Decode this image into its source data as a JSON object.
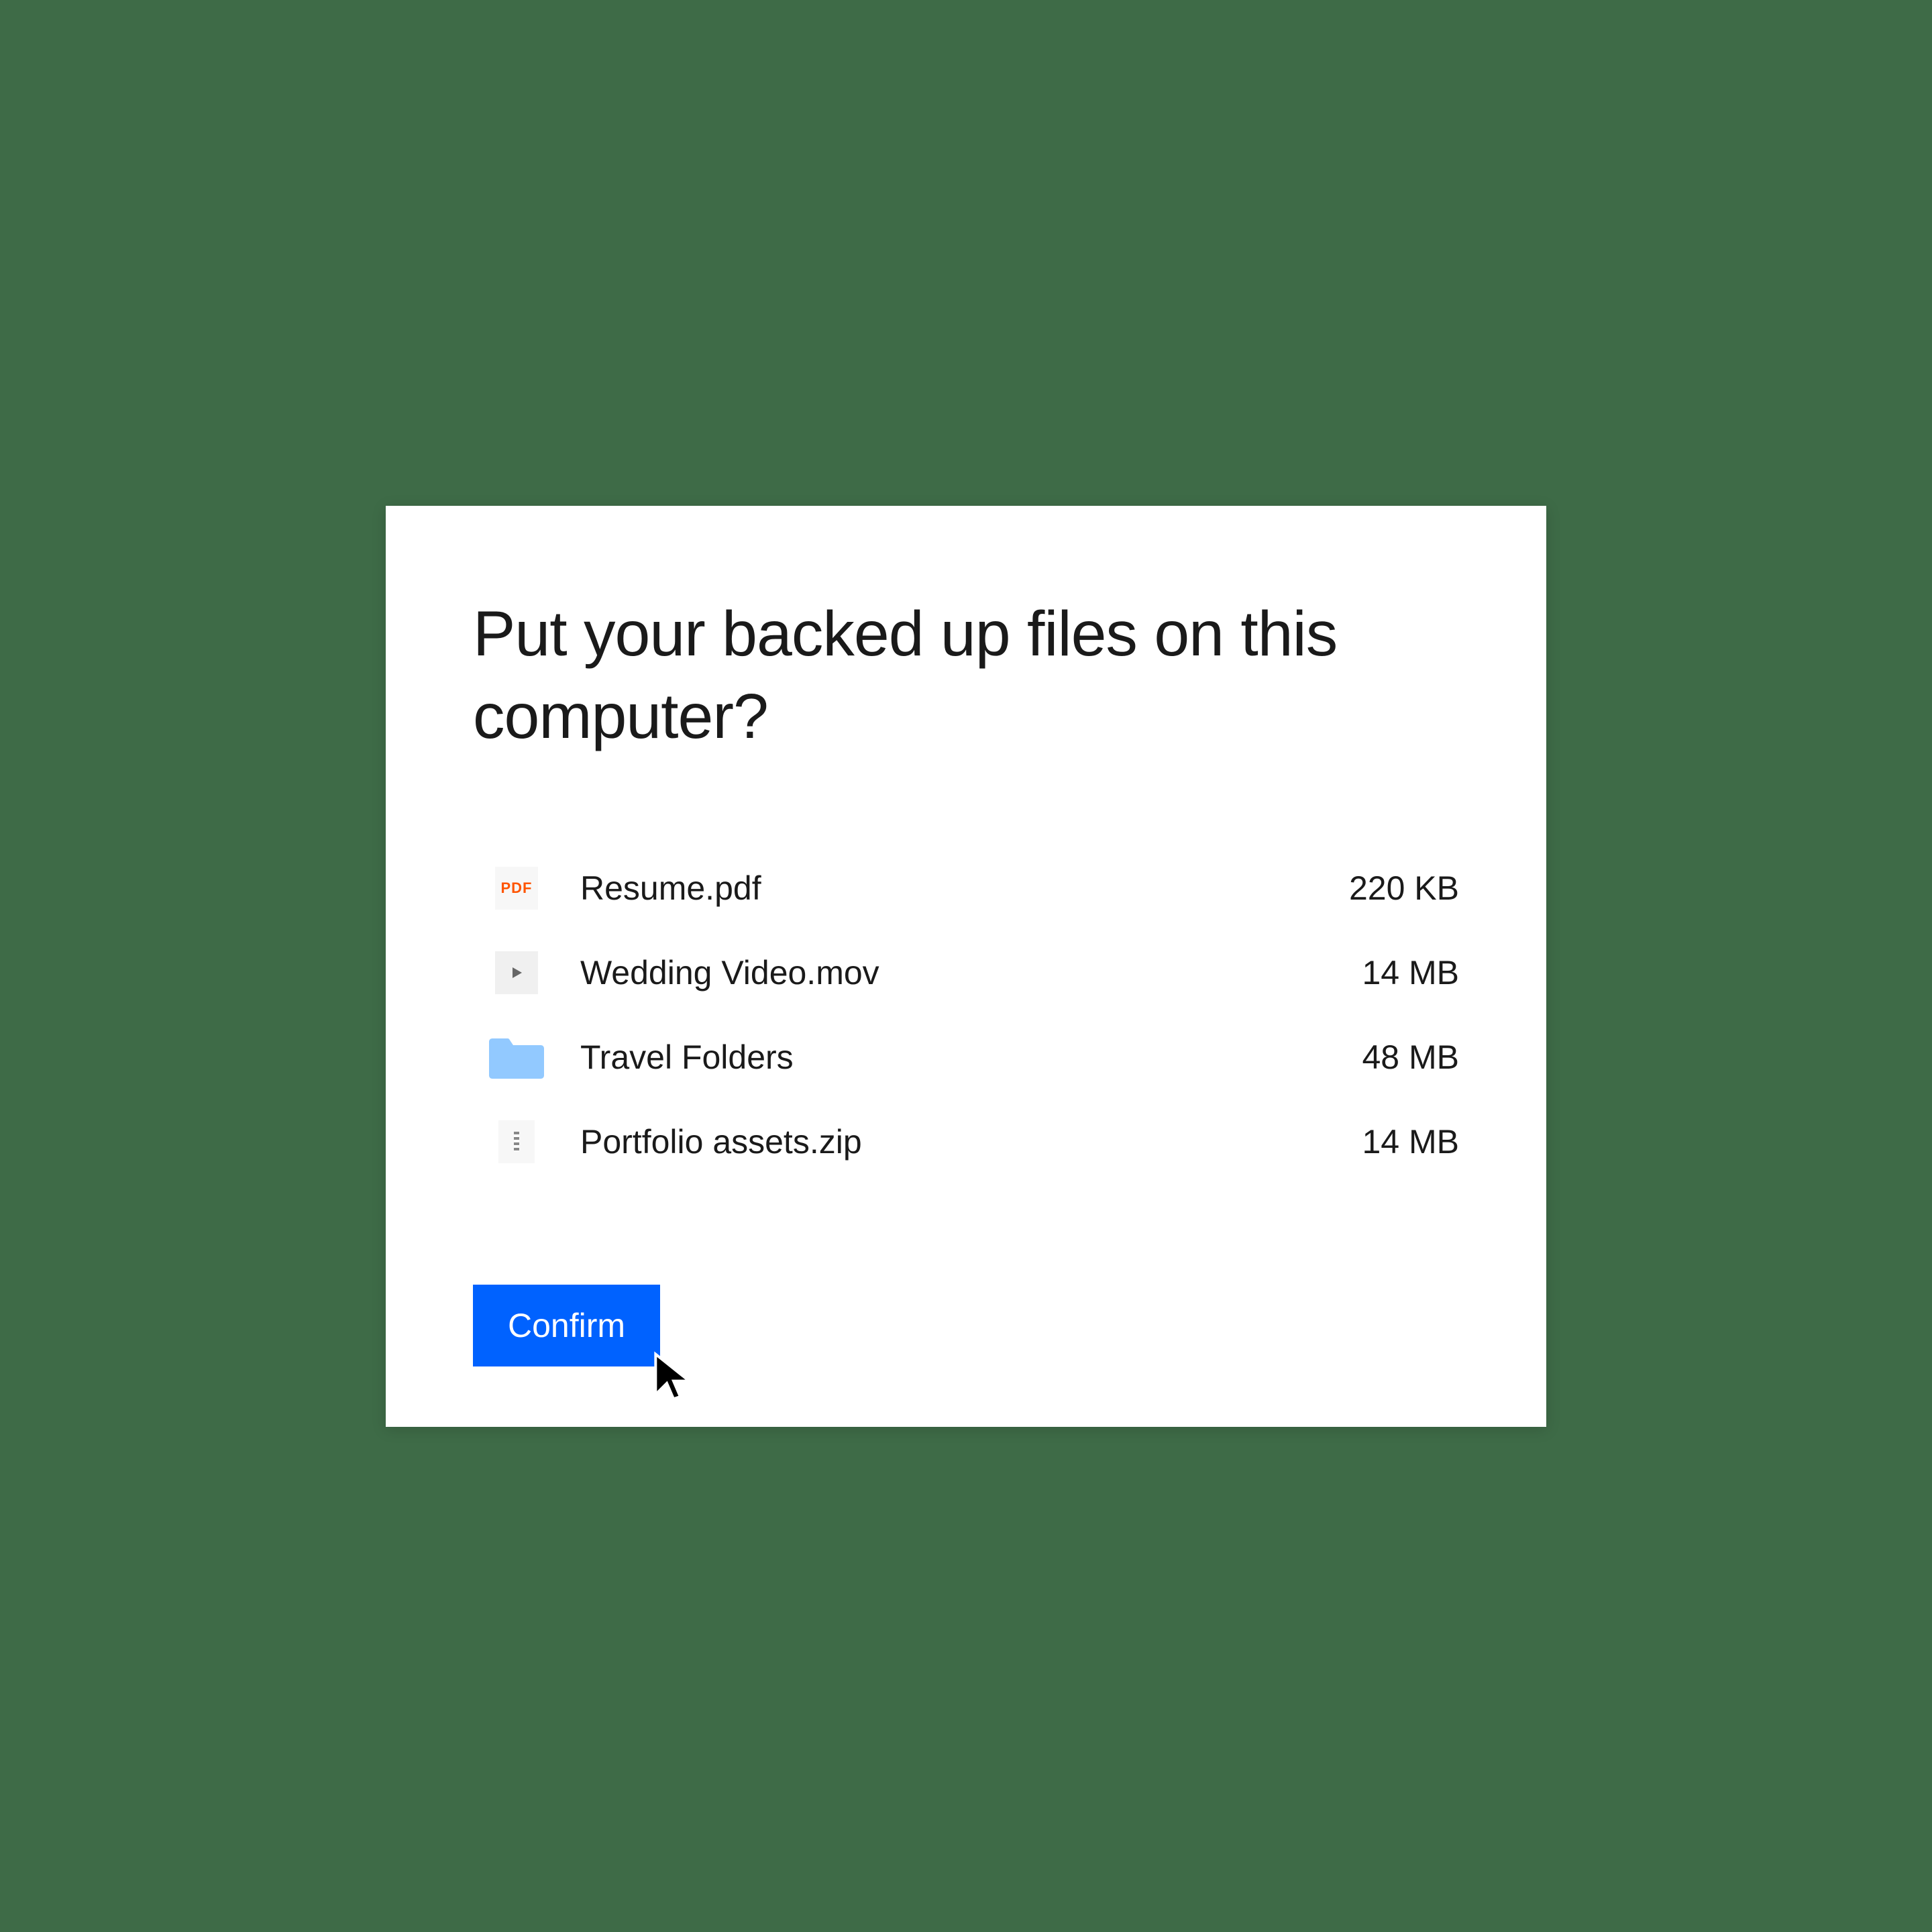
{
  "dialog": {
    "title": "Put your backed up files on this computer?",
    "confirm_label": "Confirm"
  },
  "files": [
    {
      "name": "Resume.pdf",
      "size": "220 KB",
      "icon": "pdf"
    },
    {
      "name": "Wedding Video.mov",
      "size": "14 MB",
      "icon": "video"
    },
    {
      "name": "Travel Folders",
      "size": "48 MB",
      "icon": "folder"
    },
    {
      "name": "Portfolio assets.zip",
      "size": "14 MB",
      "icon": "zip"
    }
  ],
  "icons": {
    "pdf_label": "PDF"
  },
  "colors": {
    "background": "#3e6b47",
    "dialog_bg": "#ffffff",
    "primary_button": "#0062ff",
    "folder_color": "#92c9ff",
    "pdf_color": "#ff5500"
  }
}
